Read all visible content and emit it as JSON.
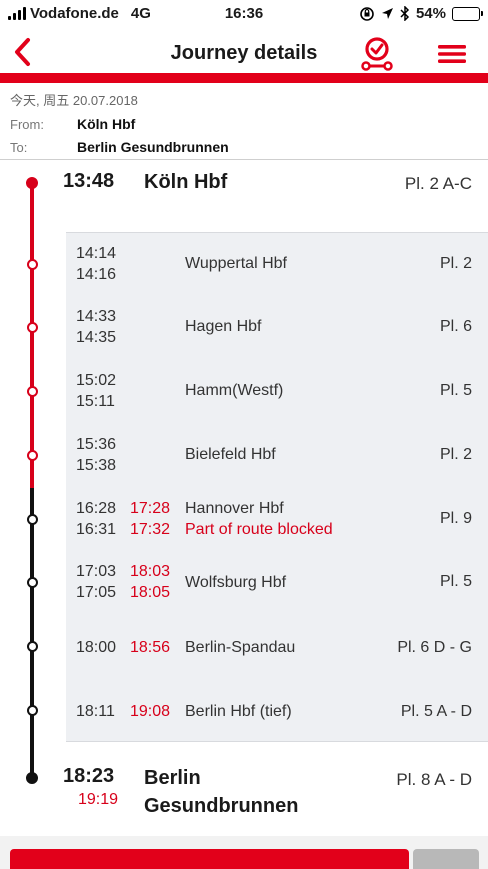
{
  "status_bar": {
    "carrier": "Vodafone.de",
    "network": "4G",
    "time": "16:36",
    "battery": "54%",
    "battery_level": 0.54
  },
  "nav": {
    "title": "Journey details",
    "back_icon": "chevron-left-icon",
    "alarm_icon": "travel-alarm-icon",
    "menu_icon": "hamburger-menu-icon"
  },
  "journey": {
    "date": "今天, 周五 20.07.2018",
    "from_label": "From:",
    "from_value": "Köln Hbf",
    "to_label": "To:",
    "to_value": "Berlin Gesundbrunnen"
  },
  "origin": {
    "time": "13:48",
    "station": "Köln Hbf",
    "platform": "Pl. 2 A-C"
  },
  "stops": [
    {
      "arr": "14:14",
      "dep": "14:16",
      "rt_arr": "",
      "rt_dep": "",
      "station": "Wuppertal Hbf",
      "note": "",
      "platform": "Pl. 2"
    },
    {
      "arr": "14:33",
      "dep": "14:35",
      "rt_arr": "",
      "rt_dep": "",
      "station": "Hagen Hbf",
      "note": "",
      "platform": "Pl. 6"
    },
    {
      "arr": "15:02",
      "dep": "15:11",
      "rt_arr": "",
      "rt_dep": "",
      "station": "Hamm(Westf)",
      "note": "",
      "platform": "Pl. 5"
    },
    {
      "arr": "15:36",
      "dep": "15:38",
      "rt_arr": "",
      "rt_dep": "",
      "station": "Bielefeld Hbf",
      "note": "",
      "platform": "Pl. 2"
    },
    {
      "arr": "16:28",
      "dep": "16:31",
      "rt_arr": "17:28",
      "rt_dep": "17:32",
      "station": "Hannover Hbf",
      "note": "Part of route blocked",
      "platform": "Pl. 9"
    },
    {
      "arr": "17:03",
      "dep": "17:05",
      "rt_arr": "18:03",
      "rt_dep": "18:05",
      "station": "Wolfsburg Hbf",
      "note": "",
      "platform": "Pl. 5"
    },
    {
      "arr": "18:00",
      "dep": "",
      "rt_arr": "18:56",
      "rt_dep": "",
      "station": "Berlin-Spandau",
      "note": "",
      "platform": "Pl. 6 D - G"
    },
    {
      "arr": "18:11",
      "dep": "",
      "rt_arr": "19:08",
      "rt_dep": "",
      "station": "Berlin Hbf (tief)",
      "note": "",
      "platform": "Pl. 5 A - D"
    }
  ],
  "destination": {
    "time": "18:23",
    "realtime": "19:19",
    "station_line1": "Berlin",
    "station_line2": "Gesundbrunnen",
    "platform": "Pl. 8 A - D"
  },
  "colors": {
    "brand_red": "#e2001a",
    "delay_red": "#d7001a",
    "panel_bg": "#eef0f3"
  }
}
